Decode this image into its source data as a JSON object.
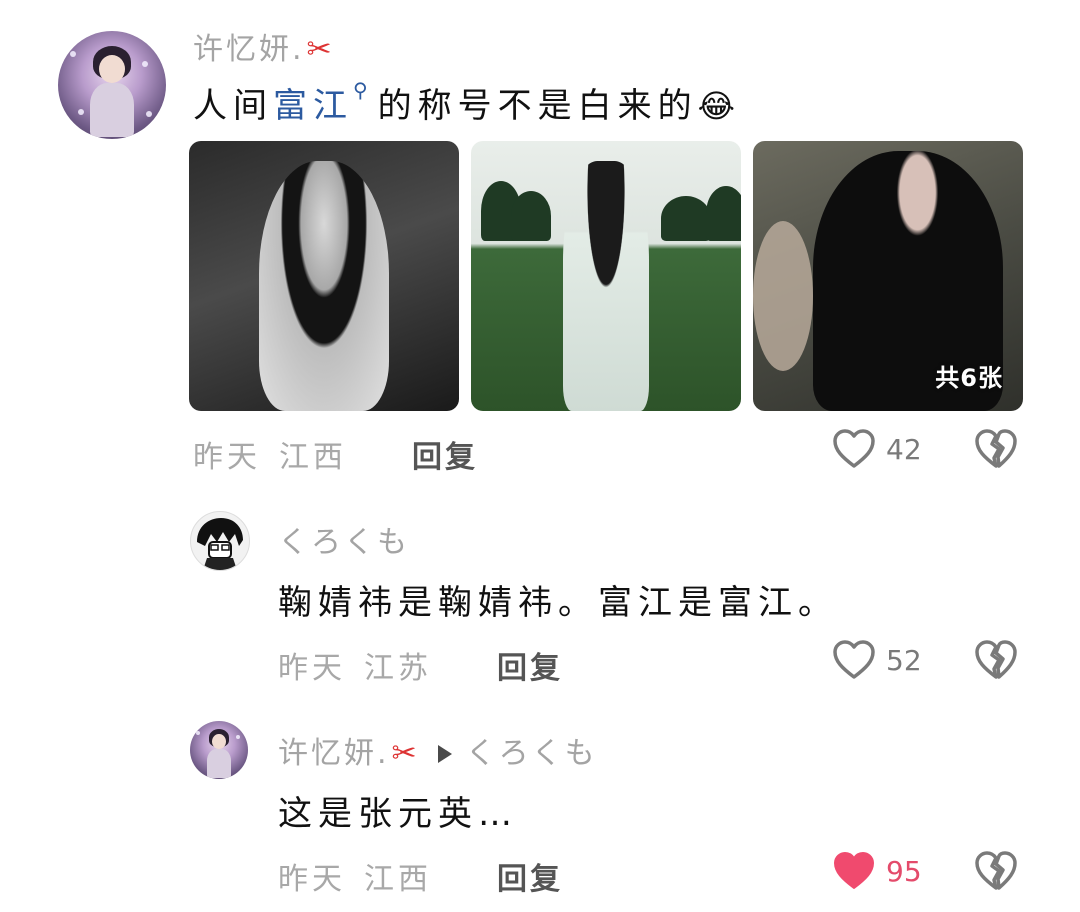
{
  "comment": {
    "username": "许忆妍.",
    "text_before": "人间",
    "keyword": "富江",
    "text_after": "的称号不是白来的",
    "emoji": "😂",
    "photo_count_label": "共6张",
    "time": "昨天",
    "location": "江西",
    "reply_label": "回复",
    "likes": "42"
  },
  "replies": [
    {
      "username": "くろくも",
      "text": "鞠婧祎是鞠婧祎。富江是富江。",
      "time": "昨天",
      "location": "江苏",
      "reply_label": "回复",
      "likes": "52",
      "liked": false
    },
    {
      "username": "许忆妍.",
      "reply_to": "くろくも",
      "text": "这是张元英…",
      "time": "昨天",
      "location": "江西",
      "reply_label": "回复",
      "likes": "95",
      "liked": true
    }
  ],
  "icons": {
    "like": "heart-outline-icon",
    "liked": "heart-filled-icon",
    "dislike": "broken-heart-icon",
    "scissors": "scissors-icon",
    "search": "search-icon"
  },
  "colors": {
    "keyword": "#2c5aa0",
    "liked": "#e44b6b",
    "meta": "#a8a8a8"
  }
}
